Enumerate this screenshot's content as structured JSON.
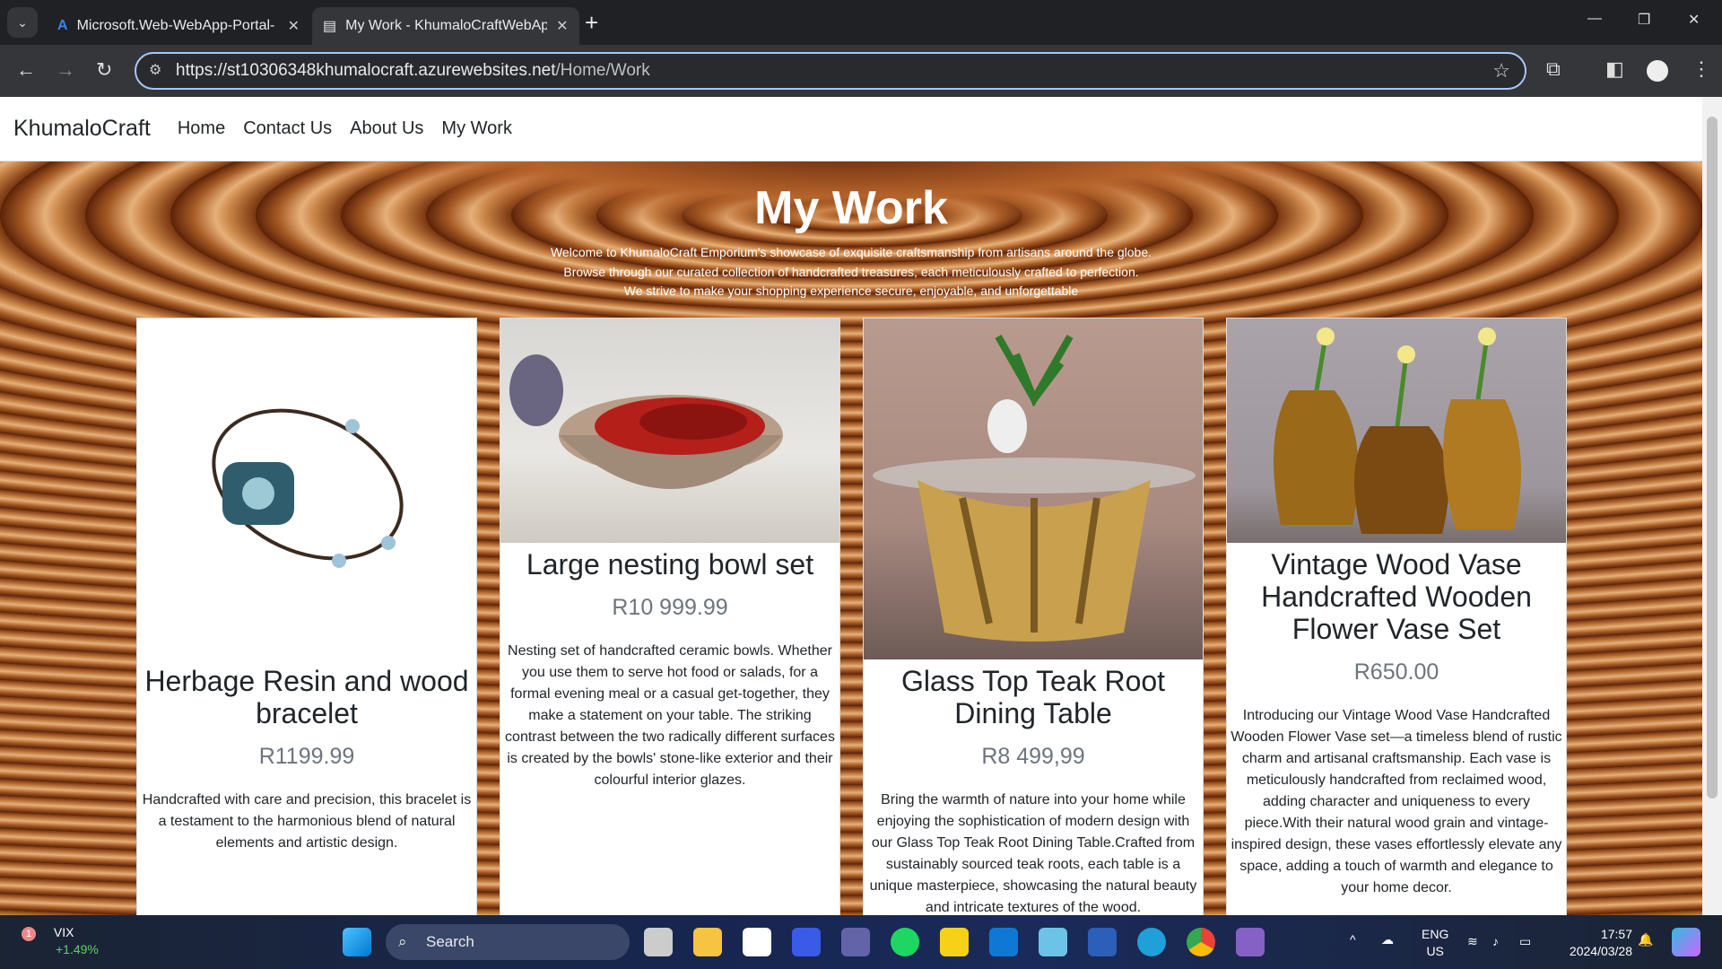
{
  "browser": {
    "tabs": [
      {
        "title": "Microsoft.Web-WebApp-Portal-",
        "icon": "azure-icon",
        "active": false
      },
      {
        "title": "My Work - KhumaloCraftWebApp",
        "icon": "page-icon",
        "active": true
      }
    ],
    "url_host": "https://st10306348khumalocraft.azurewebsites.net",
    "url_path": "/Home/Work"
  },
  "site": {
    "brand": "KhumaloCraft",
    "nav": [
      "Home",
      "Contact Us",
      "About Us",
      "My Work"
    ]
  },
  "hero": {
    "title": "My Work",
    "intro": [
      "Welcome to KhumaloCraft Emporium's showcase of exquisite craftsmanship from artisans around the globe.",
      "Browse through our curated collection of handcrafted treasures, each meticulously crafted to perfection.",
      "We strive to make your shopping experience secure, enjoyable, and unforgettable"
    ]
  },
  "products": [
    {
      "title": "Herbage Resin and wood bracelet",
      "price": "R1199.99",
      "description": "Handcrafted with care and precision, this bracelet is a testament to the harmonious blend of natural elements and artistic design."
    },
    {
      "title": "Large nesting bowl set",
      "price": "R10 999.99",
      "description": "Nesting set of handcrafted ceramic bowls. Whether you use them to serve hot food or salads, for a formal evening meal or a casual get-together, they make a statement on your table. The striking contrast between the two radically different surfaces is created by the bowls' stone-like exterior and their colourful interior glazes."
    },
    {
      "title": "Glass Top Teak Root Dining Table",
      "price": "R8 499,99",
      "description": "Bring the warmth of nature into your home while enjoying the sophistication of modern design with our Glass Top Teak Root Dining Table.Crafted from sustainably sourced teak roots, each table is a unique masterpiece, showcasing the natural beauty and intricate textures of the wood."
    },
    {
      "title": "Vintage Wood Vase Handcrafted Wooden Flower Vase Set",
      "price": "R650.00",
      "description": "Introducing our Vintage Wood Vase Handcrafted Wooden Flower Vase set—a timeless blend of rustic charm and artisanal craftsmanship. Each vase is meticulously handcrafted from reclaimed wood, adding character and uniqueness to every piece.With their natural wood grain and vintage-inspired design, these vases effortlessly elevate any space, adding a touch of warmth and elegance to your home decor."
    }
  ],
  "taskbar": {
    "stock_name": "VIX",
    "stock_change": "+1.49%",
    "stock_badge": "1",
    "search": "Search",
    "lang": "ENG",
    "region": "US",
    "time": "17:57",
    "date": "2024/03/28"
  }
}
